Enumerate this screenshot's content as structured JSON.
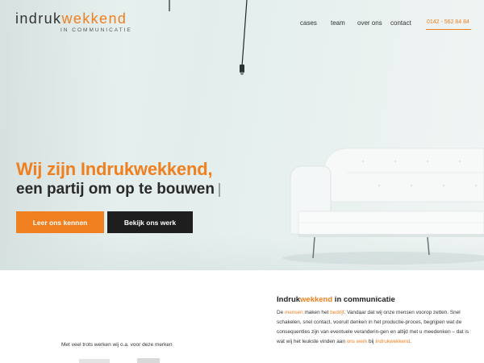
{
  "header": {
    "logo_part1": "indruk",
    "logo_part2": "wekkend",
    "logo_sub": "IN COMMUNICATIE",
    "nav": [
      {
        "label": "cases"
      },
      {
        "label": "team"
      },
      {
        "label": "over ons"
      },
      {
        "label": "contact"
      }
    ],
    "phone": "0142 - 562 84 84"
  },
  "hero": {
    "title_line1": "Wij zijn Indrukwekkend,",
    "title_line2": "een partij om op te bouwen",
    "primary_button": "Leer ons kennen",
    "secondary_button": "Bekijk ons werk"
  },
  "about": {
    "title_part1": "Indruk",
    "title_part2": "wekkend",
    "title_part3": " in communicatie",
    "text": {
      "t1": "De ",
      "l1": "mensen",
      "t2": " maken het ",
      "l2": "bedrijf",
      "t3": ". Vandaar dat wij onze mensen voorop zetten. Snel schakelen, snel contact, vooruit denken in het productie-proces, begrijpen wat de consequenties zijn van eventuele veranderin-gen en altijd met u meedenken – dat is wat wij het leukste vinden aan ",
      "l3": "ons werk",
      "t4": " bij ",
      "l4": "Indrukwekkend",
      "t5": "."
    }
  },
  "brands": {
    "label": "Met veel trots werken wij o.a. voor deze merken"
  },
  "colors": {
    "accent": "#f07f1f",
    "dark_button": "#1e1e1e",
    "hero_background": "#e6efee"
  }
}
